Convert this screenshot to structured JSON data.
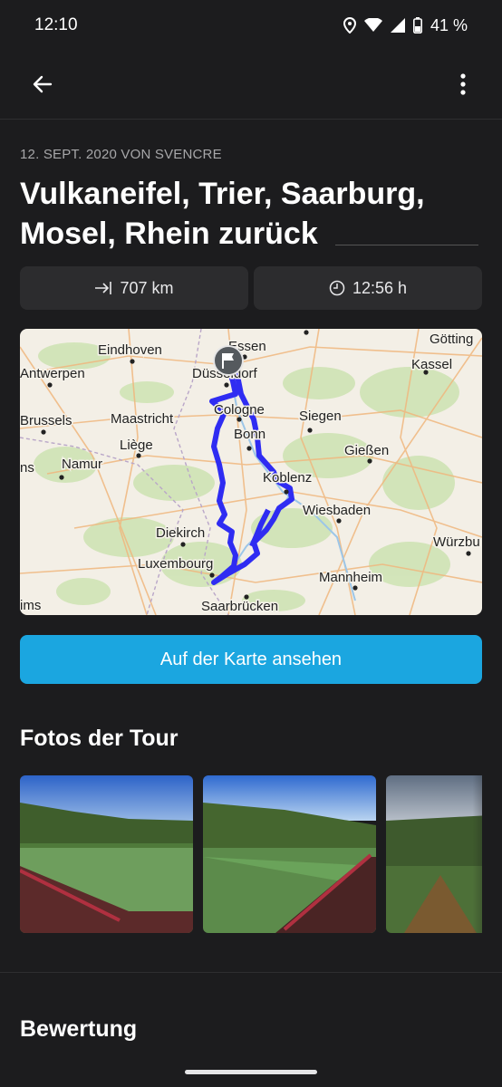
{
  "status_bar": {
    "time": "12:10",
    "battery": "41 %",
    "icons": [
      "location-icon",
      "wifi-icon",
      "signal-icon",
      "battery-icon"
    ]
  },
  "app_bar": {
    "back_icon": "arrow-left-icon",
    "menu_icon": "more-vertical-icon"
  },
  "tour": {
    "meta": "12. SEPT. 2020 VON SVENCRE",
    "title": "Vulkaneifel, Trier, Saarburg, Mosel, Rhein zurück",
    "distance": "707 km",
    "duration": "12:56 h"
  },
  "map": {
    "labels": {
      "essen": "Essen",
      "gotting": "Götting",
      "eindhoven": "Eindhoven",
      "antwerpen": "Antwerpen",
      "dusseldorf": "Düsseldorf",
      "kassel": "Kassel",
      "cologne": "Cologne",
      "maastricht": "Maastricht",
      "brussels": "Brussels",
      "siegen": "Siegen",
      "bonn": "Bonn",
      "liege": "Liège",
      "giessen": "Gießen",
      "namur": "Namur",
      "ns": "ns",
      "koblenz": "Koblenz",
      "wiesbaden": "Wiesbaden",
      "diekirch": "Diekirch",
      "wurzbu": "Würzbu",
      "luxembourg": "Luxembourg",
      "mannheim": "Mannheim",
      "ims": "ims",
      "saarbrucken": "Saarbrücken"
    },
    "route_color": "#2f2cf2",
    "flag_icon": "flag-icon"
  },
  "actions": {
    "view_on_map": "Auf der Karte ansehen"
  },
  "photos_section": {
    "title": "Fotos der Tour"
  },
  "rating_section": {
    "title": "Bewertung"
  },
  "colors": {
    "background": "#1c1c1e",
    "card": "#2c2c2e",
    "accent": "#1ba6e0"
  }
}
